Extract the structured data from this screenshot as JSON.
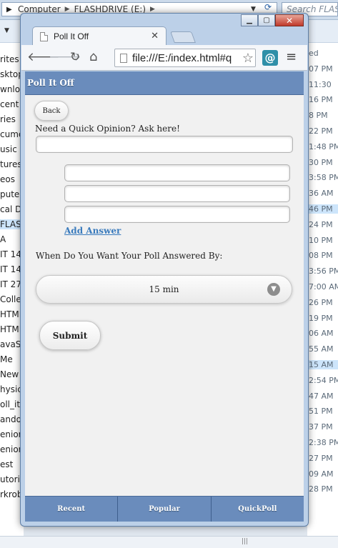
{
  "explorer": {
    "address_parts": [
      "Computer",
      "FLASHDRIVE (E:)"
    ],
    "search_placeholder": "Search FLASH...",
    "left_items": [
      "rites",
      "sktop",
      "wnlo",
      "cent F",
      "ries",
      "cume",
      "usic",
      "tures",
      "eos",
      "puter",
      "cal Dis",
      "FLASHD",
      "A",
      "IT 14",
      "IT 14",
      "IT 27",
      "Colleg",
      "HTML",
      "HTML",
      "avaSc",
      "Me",
      "New",
      "hysic",
      "oll_it",
      "ando",
      "enior",
      "enior",
      "est",
      "utoria",
      "rkrob"
    ],
    "right_items": [
      "ed",
      "07 PM",
      "11:30",
      "16 PM",
      "8 PM",
      "22 PM",
      "1:48 PM",
      "30 PM",
      "3:58 PM",
      "36 AM",
      "46 PM",
      "24 PM",
      "10 PM",
      "08 PM",
      "3:56 PM",
      "7:00 AM",
      "26 PM",
      "19 PM",
      "06 AM",
      "55 AM",
      "15 AM",
      "2:54 PM",
      "47 AM",
      "51 PM",
      "37 PM",
      "2:38 PM",
      "27 PM",
      "09 AM",
      "28 PM"
    ]
  },
  "browser": {
    "tab_title": "Poll It Off",
    "url": "file:///E:/index.html#q"
  },
  "app": {
    "header_title": "Poll It Off",
    "back_label": "Back",
    "question_label": "Need a Quick Opinion? Ask here!",
    "question_value": "",
    "answers": [
      "",
      "",
      ""
    ],
    "add_answer_label": "Add Answer",
    "deadline_label": "When Do You Want Your Poll Answered By:",
    "deadline_value": "15 min",
    "submit_label": "Submit",
    "footer_tabs": [
      "Recent",
      "Popular",
      "QuickPoll"
    ]
  }
}
